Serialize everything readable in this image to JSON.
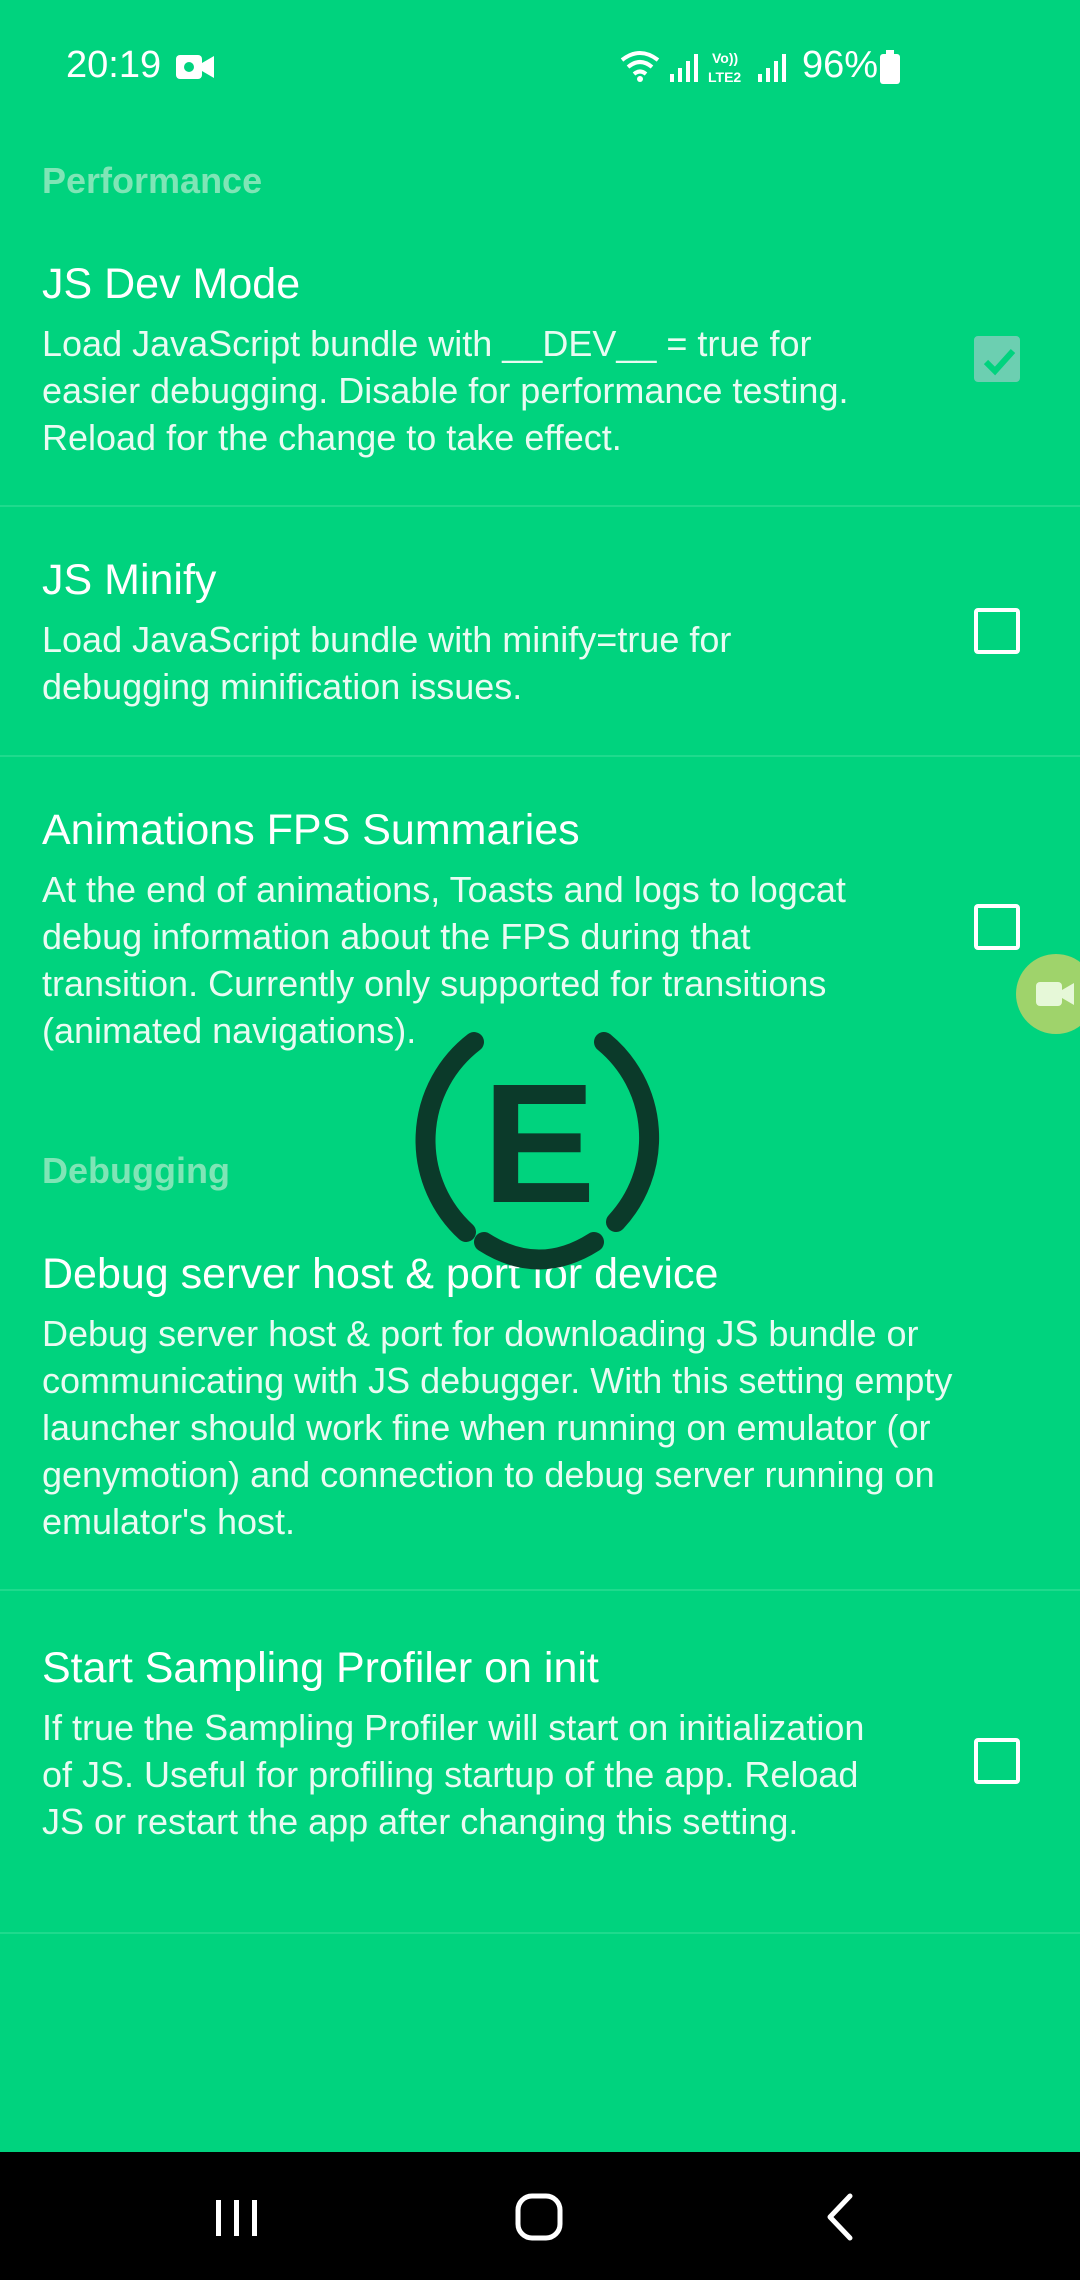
{
  "status_bar": {
    "time": "20:19",
    "battery_text": "96%",
    "icons": [
      "video-record-icon",
      "wifi-icon",
      "signal-icon",
      "volte-icon",
      "signal-icon-2",
      "battery-icon"
    ]
  },
  "sections": {
    "performance_header": "Performance",
    "debugging_header": "Debugging"
  },
  "prefs": {
    "js_dev_mode": {
      "title": "JS Dev Mode",
      "summary": "Load JavaScript bundle with __DEV__ = true for easier debugging. Disable for performance testing. Reload for the change to take effect.",
      "checked": true
    },
    "js_minify": {
      "title": "JS Minify",
      "summary": "Load JavaScript bundle with minify=true for debugging minification issues.",
      "checked": false
    },
    "animations_fps": {
      "title": "Animations FPS Summaries",
      "summary": "At the end of animations, Toasts and logs to logcat debug information about the FPS during that transition. Currently only supported for transitions (animated navigations).",
      "checked": false
    },
    "debug_server": {
      "title": "Debug server host & port for device",
      "summary": "Debug server host & port for downloading JS bundle or communicating with JS debugger. With this setting empty launcher should work fine when running on emulator (or genymotion) and connection to debug server running on emulator's host."
    },
    "sampling_profiler": {
      "title": "Start Sampling Profiler on init",
      "summary": "If true the Sampling Profiler will start on initialization of JS. Useful for profiling startup of the app. Reload JS or restart the app after changing this setting.",
      "checked": false
    }
  },
  "colors": {
    "background": "#00d37e",
    "section_header": "#7fe5b6",
    "checked_box": "#6ccfb1",
    "nav_bar": "#000000",
    "watermark": "#0b3a2a"
  },
  "watermark": {
    "letter": "E"
  },
  "nav": {
    "recents": "recents-icon",
    "home": "home-icon",
    "back": "back-icon"
  }
}
